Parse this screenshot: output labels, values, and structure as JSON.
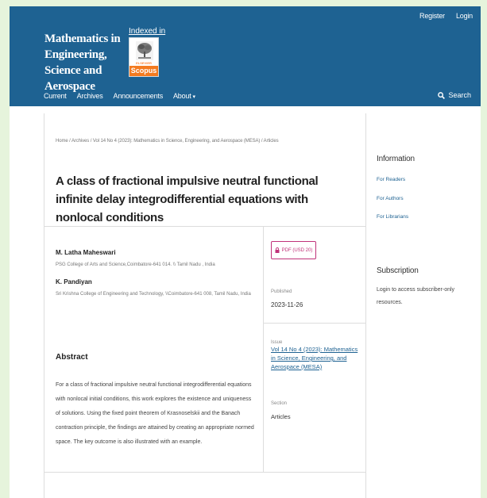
{
  "header": {
    "user_nav": {
      "register": "Register",
      "login": "Login"
    },
    "site_title": "Mathematics in Engineering, Science and Aerospace",
    "indexed_in": "Indexed in",
    "scopus": {
      "publisher": "ELSEVIER",
      "label": "Scopus"
    },
    "nav": {
      "current": "Current",
      "archives": "Archives",
      "announcements": "Announcements",
      "about": "About"
    },
    "search": "Search"
  },
  "breadcrumb": "Home  /  Archives  /  Vol 14 No 4 (2023): Mathematics in Science, Engineering, and Aerospace (MESA)  /  Articles",
  "article": {
    "title": "A class of fractional impulsive neutral functional infinite delay integrodifferential equations with nonlocal conditions",
    "authors": [
      {
        "name": "M. Latha Maheswari",
        "affiliation": "PSG College of Arts and Science,Coimbatore-641 014. \\\\ Tamil Nadu , India"
      },
      {
        "name": "K. Pandiyan",
        "affiliation": "Sri Krishna College of Engineering and Technology, \\\\Coimbatore-641 008, Tamil Nadu, India"
      }
    ],
    "abstract_heading": "Abstract",
    "abstract": "For a class of fractional impulsive neutral functional integrodifferential equations with nonlocal initial conditions, this work explores the existence and uniqueness of solutions. Using the fixed point theorem of Krasnoselskii and the Banach contraction principle, the findings are attained by creating an appropriate normed space. The key outcome is also illustrated with an example.",
    "pdf_button": "PDF (USD 20)",
    "published_label": "Published",
    "published_date": "2023-11-26",
    "issue_label": "Issue",
    "issue_link": "Vol 14 No 4 (2023): Mathematics in Science, Engineering, and Aerospace (MESA)",
    "section_label": "Section",
    "section_value": "Articles"
  },
  "sidebar": {
    "information_heading": "Information",
    "links": [
      "For Readers",
      "For Authors",
      "For Librarians"
    ],
    "subscription_heading": "Subscription",
    "subscription_text": "Login to access subscriber-only resources."
  },
  "colors": {
    "header_bg": "#1e6292",
    "link": "#1e6292",
    "pdf_accent": "#c0337a",
    "page_frame": "#e6f4dc"
  }
}
